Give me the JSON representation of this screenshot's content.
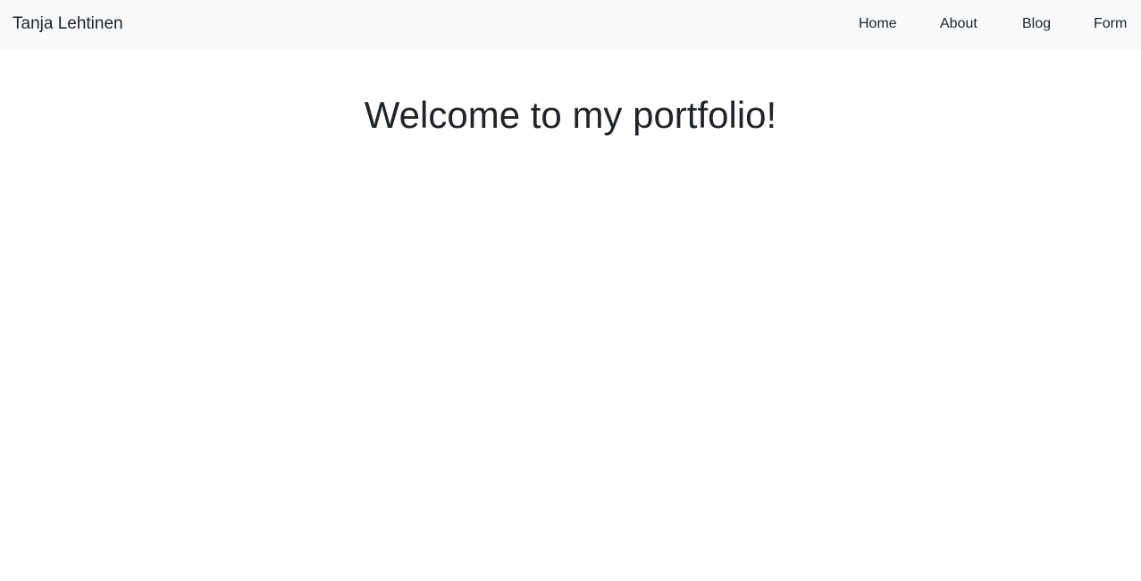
{
  "navbar": {
    "brand": "Tanja Lehtinen",
    "links": [
      {
        "label": "Home"
      },
      {
        "label": "About"
      },
      {
        "label": "Blog"
      },
      {
        "label": "Form"
      }
    ]
  },
  "main": {
    "heading": "Welcome to my portfolio!"
  },
  "colors": {
    "navbar_bg": "#f8f9fa",
    "text": "#212529",
    "page_bg": "#ffffff"
  }
}
